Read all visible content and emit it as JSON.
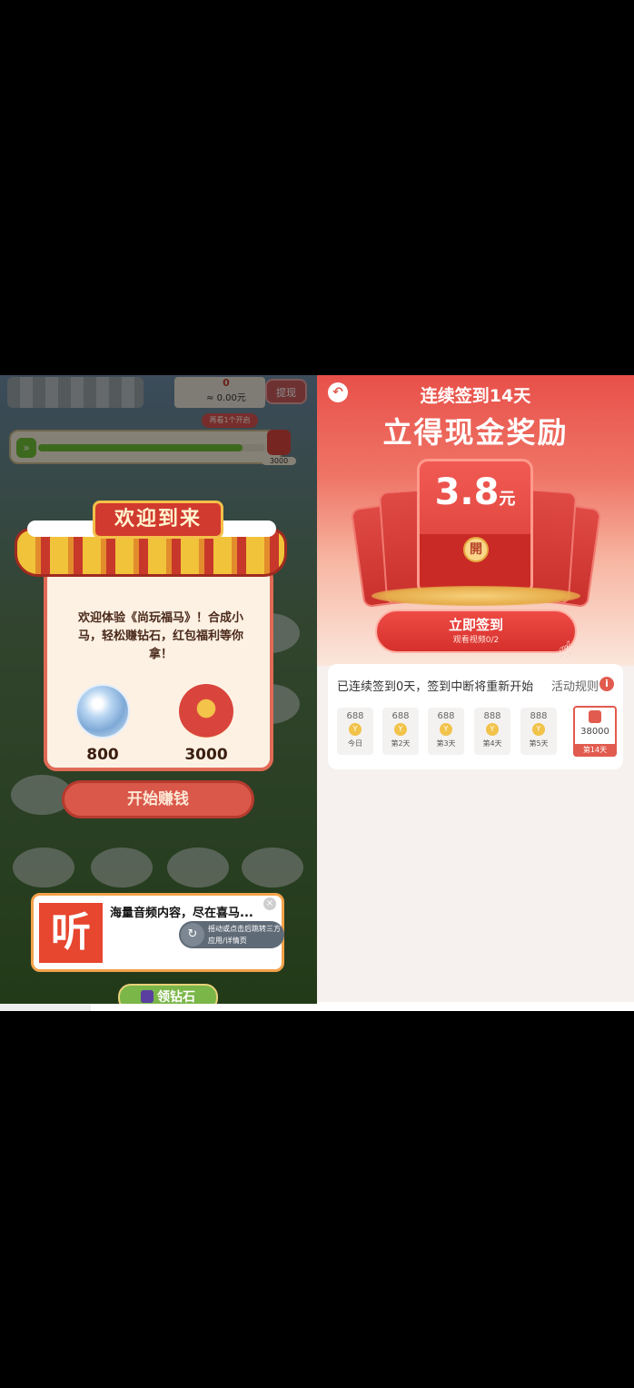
{
  "left": {
    "coin_count": "0",
    "cash": "≈ 0.00元",
    "withdraw_label": "提现",
    "hint": "再看1个开启",
    "progress_fraction": 0.9,
    "red_chip_value": "3000",
    "dialog": {
      "title": "欢迎到来",
      "body": "欢迎体验《尚玩福马》！合成小马，轻松赚钻石，红包福利等你拿！",
      "rewards": [
        {
          "icon": "diamond-icon",
          "value": "800"
        },
        {
          "icon": "red-envelope-icon",
          "value": "3000"
        }
      ],
      "start_label": "开始赚钱"
    },
    "ad": {
      "logo_text": "听",
      "title": "海量音频内容，尽在喜马...",
      "shake_text": "摇动或点击后跳转三方应用/详情页",
      "close": "×"
    },
    "bottom_button": "领钻石"
  },
  "right": {
    "back_icon": "back-arrow-icon",
    "subtitle": "连续签到14天",
    "title": "立得现金奖励",
    "amount": "3.8",
    "amount_unit": "元",
    "seal": "開",
    "sign_label": "立即签到",
    "sign_sub": "观看视频0/2",
    "streak_text": "已连续签到0天，签到中断将重新开始",
    "rules_label": "活动规则",
    "days": [
      {
        "pts": "688",
        "label": "今日"
      },
      {
        "pts": "688",
        "label": "第2天"
      },
      {
        "pts": "688",
        "label": "第3天"
      },
      {
        "pts": "888",
        "label": "第4天"
      },
      {
        "pts": "888",
        "label": "第5天"
      }
    ],
    "final_day": {
      "pts": "38000",
      "label": "第14天"
    },
    "coin_glyph": "Y"
  },
  "colors": {
    "accent": "#e25b4f",
    "dialog_border": "#e06a55",
    "progress": "#6fbf3a"
  }
}
